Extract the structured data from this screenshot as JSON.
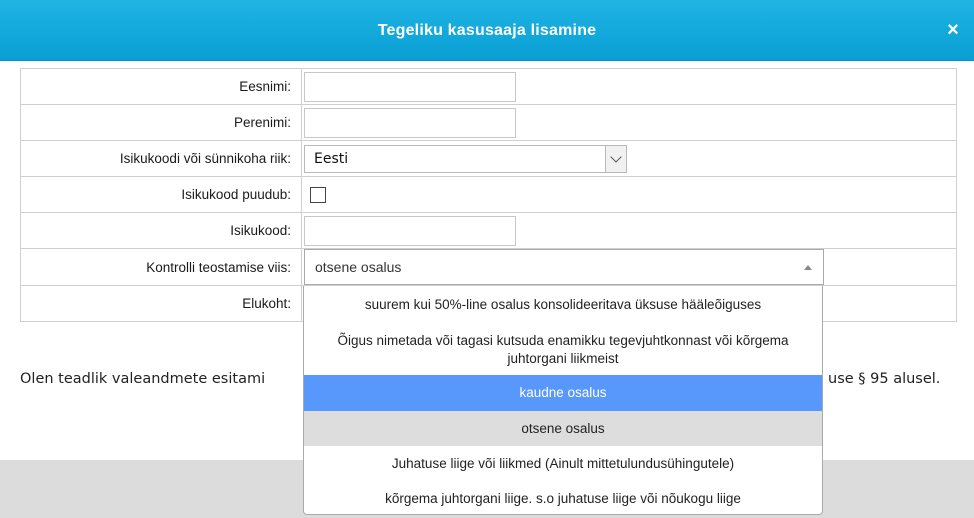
{
  "dialog": {
    "title": "Tegeliku kasusaaja lisamine",
    "close_glyph": "×"
  },
  "form": {
    "first_name": {
      "label": "Eesnimi:",
      "value": ""
    },
    "last_name": {
      "label": "Perenimi:",
      "value": ""
    },
    "country": {
      "label": "Isikukoodi või sünnikoha riik:",
      "value": "Eesti"
    },
    "no_id_code": {
      "label": "Isikukood puudub:",
      "checked": false
    },
    "id_code": {
      "label": "Isikukood:",
      "value": ""
    },
    "control_method": {
      "label": "Kontrolli teostamise viis:",
      "value": "otsene osalus",
      "options": [
        "suurem kui 50%-line osalus konsolideeritava üksuse hääleõiguses",
        "Õigus nimetada või tagasi kutsuda enamikku tegevjuhtkonnast või kõrgema juhtorgani liikmeist",
        "kaudne osalus",
        "otsene osalus",
        "Juhatuse liige või liikmed (Ainult mittetulundusühingutele)",
        "kõrgema juhtorgani liige. s.o juhatuse liige või nõukogu liige"
      ],
      "highlighted_index": 2,
      "selected_index": 3
    },
    "residence": {
      "label": "Elukoht:"
    }
  },
  "notice": {
    "text_left": "Olen teadlik valeandmete esitami",
    "text_right": "use § 95 alusel."
  },
  "colors": {
    "header": "#0a9fd4",
    "highlight": "#5897fb",
    "selected": "#dddddd",
    "backdrop": "#dcdcdc"
  }
}
